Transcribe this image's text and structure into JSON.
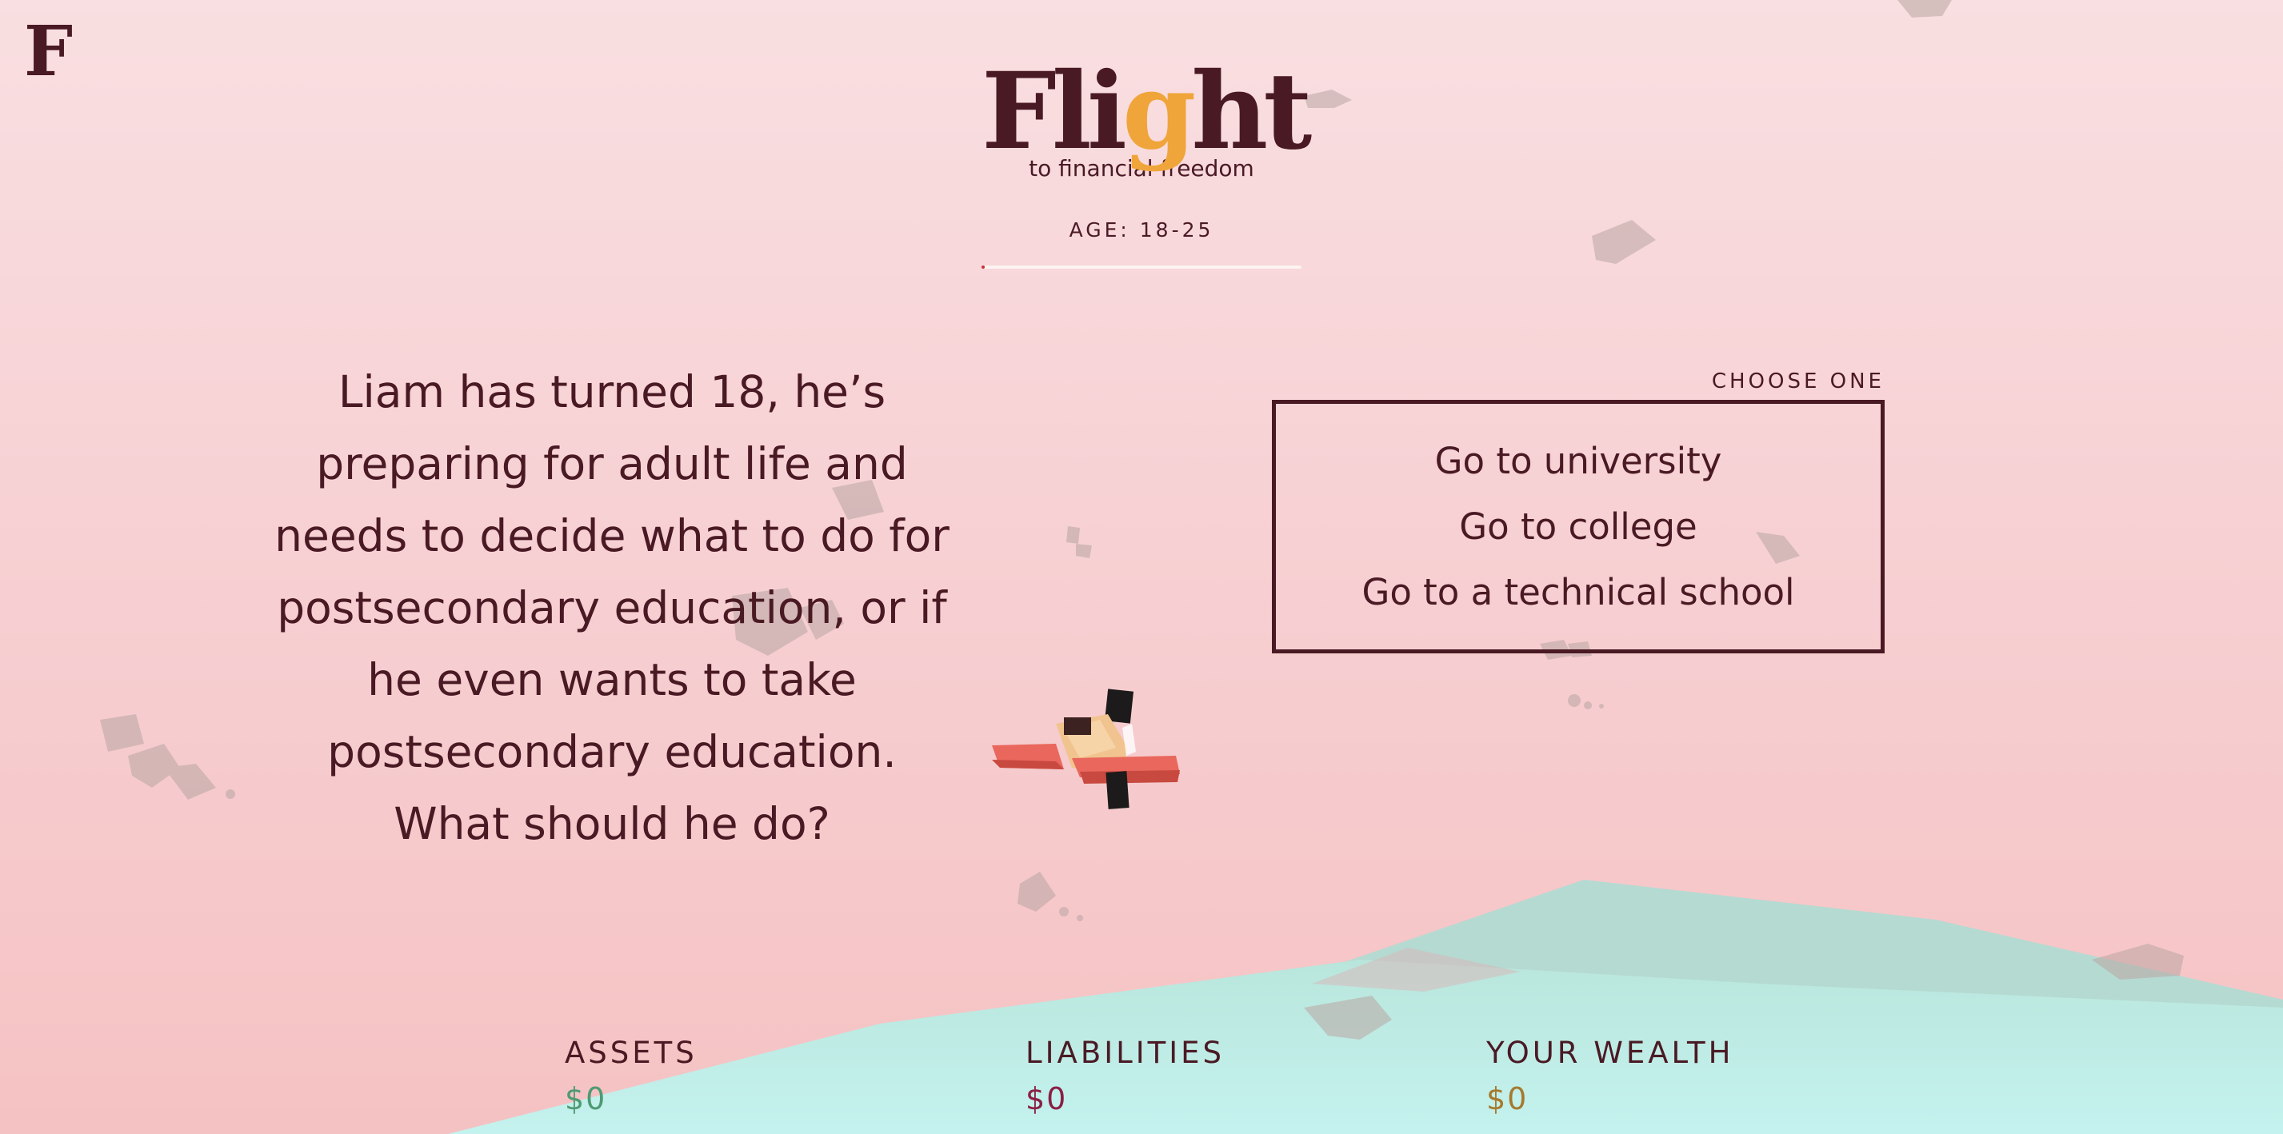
{
  "brand": {
    "mark": "F"
  },
  "header": {
    "logo_parts": [
      "Fli",
      "g",
      "ht"
    ],
    "tagline": "to financial freedom",
    "age_label": "AGE: 18-25",
    "progress": 0.01
  },
  "scenario": {
    "text": "Liam has turned 18, he’s preparing for adult life and needs to decide what to do for postsecondary education, or if he even wants to take postsecondary education. What should he do?"
  },
  "choices": {
    "label": "CHOOSE ONE",
    "options": [
      "Go to university",
      "Go to college",
      "Go to a technical school"
    ]
  },
  "stats": {
    "assets": {
      "label": "ASSETS",
      "value": "$0"
    },
    "liabilities": {
      "label": "LIABILITIES",
      "value": "$0"
    },
    "wealth": {
      "label": "YOUR WEALTH",
      "value": "$0"
    }
  },
  "colors": {
    "text": "#4a1a24",
    "logo_accent": "#f0a53a",
    "assets": "#4f9a73",
    "liabilities": "#8a1f45",
    "wealth": "#a67a2e",
    "hill": "#b6ece6"
  }
}
